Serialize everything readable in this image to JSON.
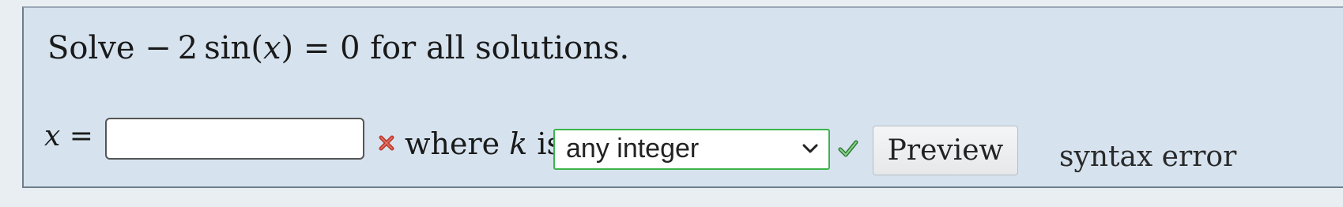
{
  "question": {
    "prefix": "Solve",
    "equation": {
      "minus": "−",
      "coef": "2",
      "func": "sin",
      "open": "(",
      "var": "x",
      "close": ")",
      "equals": "=",
      "rhs": "0"
    },
    "suffix": "for all solutions."
  },
  "answer": {
    "label_var": "x",
    "label_eq": "=",
    "value": "",
    "status": "incorrect",
    "status_icon": "x-mark-icon"
  },
  "domain": {
    "where": "where",
    "var": "k",
    "is": "is",
    "select_value": "any integer",
    "status": "correct",
    "status_icon": "check-icon"
  },
  "buttons": {
    "preview": "Preview"
  },
  "feedback": {
    "message": "syntax error"
  },
  "colors": {
    "panel_bg": "#d6e3ef",
    "correct_border": "#3cb54a",
    "incorrect_icon": "#c0392b"
  }
}
